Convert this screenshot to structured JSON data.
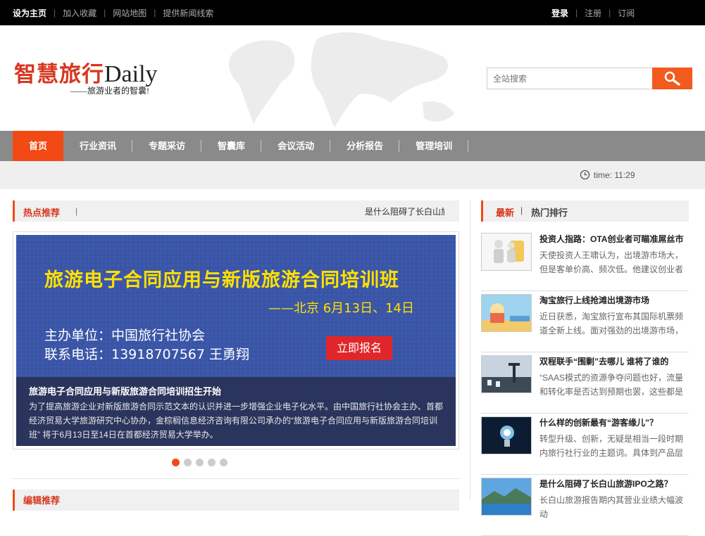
{
  "topbar": {
    "left": [
      "设为主页",
      "加入收藏",
      "网站地图",
      "提供新闻线索"
    ],
    "right": [
      "登录",
      "注册",
      "订阅"
    ]
  },
  "logo": {
    "cn": "智慧旅行",
    "en": "Daily",
    "slogan": "——旅游业者的智囊!"
  },
  "search": {
    "placeholder": "全站搜索",
    "button_icon": "search-icon"
  },
  "nav": [
    "首页",
    "行业资讯",
    "专题采访",
    "智囊库",
    "会议活动",
    "分析报告",
    "管理培训"
  ],
  "time": {
    "label": "time:",
    "value": "11:29"
  },
  "hot": {
    "title": "热点推荐",
    "divider": "|",
    "ticker": "是什么阻碍了长白山旅"
  },
  "banner": {
    "headline": "旅游电子合同应用与新版旅游合同培训班",
    "subline": "——北京  6月13日、14日",
    "organizer": "主办单位：中国旅行社协会",
    "phone": "联系电话：13918707567 王勇翔",
    "register": "立即报名",
    "caption_title": "旅游电子合同应用与新版旅游合同培训招生开始",
    "caption_text": "为了提高旅游企业对新版旅游合同示范文本的认识并进一步增强企业电子化水平。由中国旅行社协会主办、首都经济贸易大学旅游研究中心协办，金棕榈信息经济咨询有限公司承办的“旅游电子合同应用与新版旅游合同培训班” 将于6月13日至14日在首都经济贸易大学举办。"
  },
  "slider": {
    "count": 5,
    "active": 0
  },
  "editor": {
    "title": "编辑推荐"
  },
  "side": {
    "tab_latest": "最新",
    "divider": "|",
    "tab_rank": "热门排行",
    "news": [
      {
        "title": "投资人指路：OTA创业者可瞄准屌丝市",
        "desc": "天使投资人王啸认为，出境游市场大，但是客单价高、频次低。他建议创业者"
      },
      {
        "title": "淘宝旅行上线抢滩出境游市场",
        "desc": "近日获悉，淘宝旅行宣布其国际机票频道全新上线。面对强劲的出境游市场，"
      },
      {
        "title": "双程联手“围剿”去哪儿 谁将了谁的",
        "desc": "“SAAS模式的资源争夺问题也好，流量和转化率是否达到预期也罢，这些都是"
      },
      {
        "title": "什么样的创新最有“游客缘儿”？",
        "desc": "转型升级、创新，无疑是相当一段时期内旅行社行业的主题词。具体到产品层"
      },
      {
        "title": "是什么阻碍了长白山旅游IPO之路？",
        "desc": "长白山旅游报告期内其营业业绩大幅波动"
      }
    ]
  },
  "colors": {
    "accent": "#f24a14",
    "nav_bg": "#8a8a8a",
    "banner_bg": "#3a55a6",
    "banner_title": "#ffe100"
  }
}
